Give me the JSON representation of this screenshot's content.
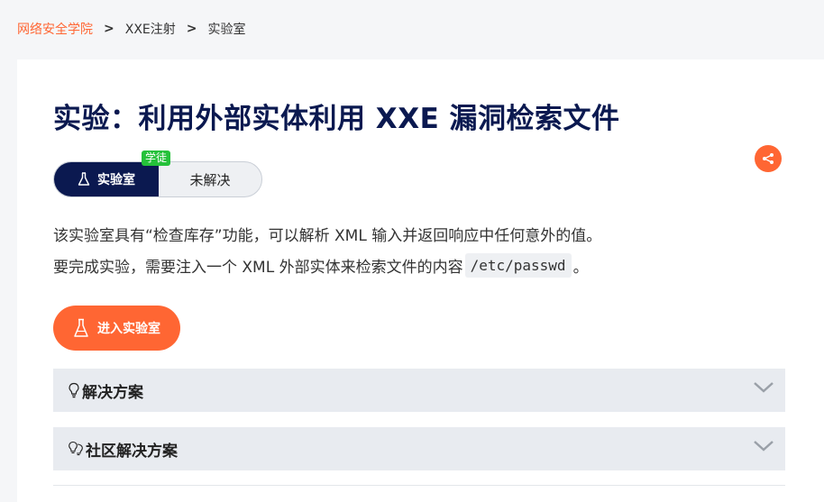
{
  "breadcrumb": {
    "home": "网络安全学院",
    "separator": ">",
    "section": "XXE注射",
    "current": "实验室"
  },
  "lab": {
    "title": "实验：利用外部实体利用 XXE 漏洞检索文件",
    "badge_type": "实验室",
    "badge_status": "未解决",
    "level": "学徒",
    "description_1": "该实验室具有“检查库存”功能，可以解析 XML 输入并返回响应中任何意外的值。",
    "description_2_prefix": "要完成实验，需要注入一个 XML 外部实体来检索文件的内容",
    "description_2_code": "/etc/passwd",
    "description_2_suffix": "。",
    "access_button": "进入实验室"
  },
  "accordions": [
    {
      "label": "解决方案",
      "icon": "lightbulb-icon"
    },
    {
      "label": "社区解决方案",
      "icon": "lightbulbs-icon"
    }
  ],
  "colors": {
    "accent": "#ff6633",
    "navy": "#0b1950",
    "level_green": "#25c13a",
    "accordion_bg": "#e8ebf0"
  }
}
